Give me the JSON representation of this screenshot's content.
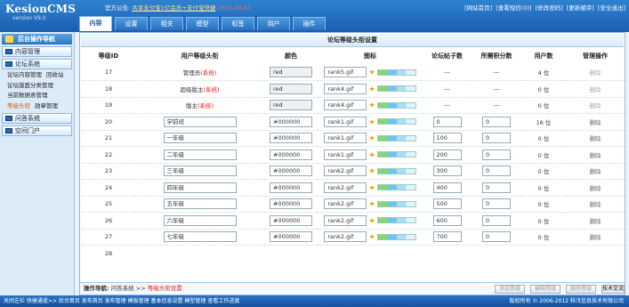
{
  "brand": {
    "name": "KesionCMS",
    "version": "version V9.0"
  },
  "notice": {
    "label": "官方公告:",
    "link": "共享支付宝1亿会员+支付宝快捷",
    "time": "2013-09-01"
  },
  "toplinks": [
    "[网站首页]",
    "[查看短信(0)]",
    "[修改密码]",
    "[更新缓存]",
    "[安全退出]"
  ],
  "tabs": [
    "内容",
    "设置",
    "相关",
    "模型",
    "标签",
    "用户",
    "插件"
  ],
  "sidebar": {
    "header": "后台操作导航",
    "sec_content": "内容管理",
    "sec_forum": "论坛系统",
    "items": [
      {
        "a": "论坛内容管理",
        "b": "回收站"
      },
      {
        "a": "论坛版面分类管理",
        "b": ""
      },
      {
        "a": "当前数据表管理",
        "b": ""
      },
      {
        "a": "等级头衔",
        "b": "勋章管理"
      }
    ],
    "sec_qa": "问答系统",
    "sec_space": "空间门户"
  },
  "page_title": "论坛等级头衔设置",
  "table": {
    "headers": [
      "等级ID",
      "用户等级头衔",
      "颜色",
      "图标",
      "论坛帖子数",
      "所需积分数",
      "用户数",
      "管理操作"
    ],
    "rows": [
      {
        "id": "17",
        "title": "管理员",
        "sys": "(系统)",
        "color": "red",
        "icon": "rank5.gif",
        "posts": "---",
        "score": "---",
        "users": "4 位",
        "op": "删除"
      },
      {
        "id": "18",
        "title": "超级版主",
        "sys": "(系统)",
        "color": "red",
        "icon": "rank4.gif",
        "posts": "---",
        "score": "---",
        "users": "0 位",
        "op": "删除"
      },
      {
        "id": "19",
        "title": "版主",
        "sys": "(系统)",
        "color": "red",
        "icon": "rank4.gif",
        "posts": "---",
        "score": "---",
        "users": "0 位",
        "op": "删除"
      },
      {
        "id": "20",
        "title": "学前班",
        "sys": "",
        "color": "#000000",
        "icon": "rank1.gif",
        "posts": "0",
        "score": "0",
        "users": "16 位",
        "op": "删除"
      },
      {
        "id": "21",
        "title": "一年级",
        "sys": "",
        "color": "#000000",
        "icon": "rank1.gif",
        "posts": "100",
        "score": "0",
        "users": "0 位",
        "op": "删除"
      },
      {
        "id": "22",
        "title": "二年级",
        "sys": "",
        "color": "#000000",
        "icon": "rank1.gif",
        "posts": "200",
        "score": "0",
        "users": "0 位",
        "op": "删除"
      },
      {
        "id": "23",
        "title": "三年级",
        "sys": "",
        "color": "#000000",
        "icon": "rank2.gif",
        "posts": "300",
        "score": "0",
        "users": "0 位",
        "op": "删除"
      },
      {
        "id": "24",
        "title": "四年级",
        "sys": "",
        "color": "#000000",
        "icon": "rank2.gif",
        "posts": "400",
        "score": "0",
        "users": "0 位",
        "op": "删除"
      },
      {
        "id": "25",
        "title": "五年级",
        "sys": "",
        "color": "#000000",
        "icon": "rank2.gif",
        "posts": "500",
        "score": "0",
        "users": "0 位",
        "op": "删除"
      },
      {
        "id": "26",
        "title": "六年级",
        "sys": "",
        "color": "#000000",
        "icon": "rank2.gif",
        "posts": "600",
        "score": "0",
        "users": "0 位",
        "op": "删除"
      },
      {
        "id": "27",
        "title": "七年级",
        "sys": "",
        "color": "#000000",
        "icon": "rank2.gif",
        "posts": "700",
        "score": "0",
        "users": "0 位",
        "op": "删除"
      }
    ],
    "partial_row": {
      "id": "28"
    }
  },
  "opbar": {
    "label": "操作导航:",
    "path": "问答系统",
    "sep": ">>",
    "current": "等级头衔设置",
    "buttons": [
      "添加等级",
      "编辑等级",
      "删除等级",
      "技术交流"
    ]
  },
  "status": {
    "text": "关闭左栏   快捷通道>>   后台首页   发布首页   发布管理   模板管理   基本信息设置   模型管理   查看工作进度",
    "copyright": "版权所有 © 2006-2012 科汛信息技术有限公司"
  }
}
